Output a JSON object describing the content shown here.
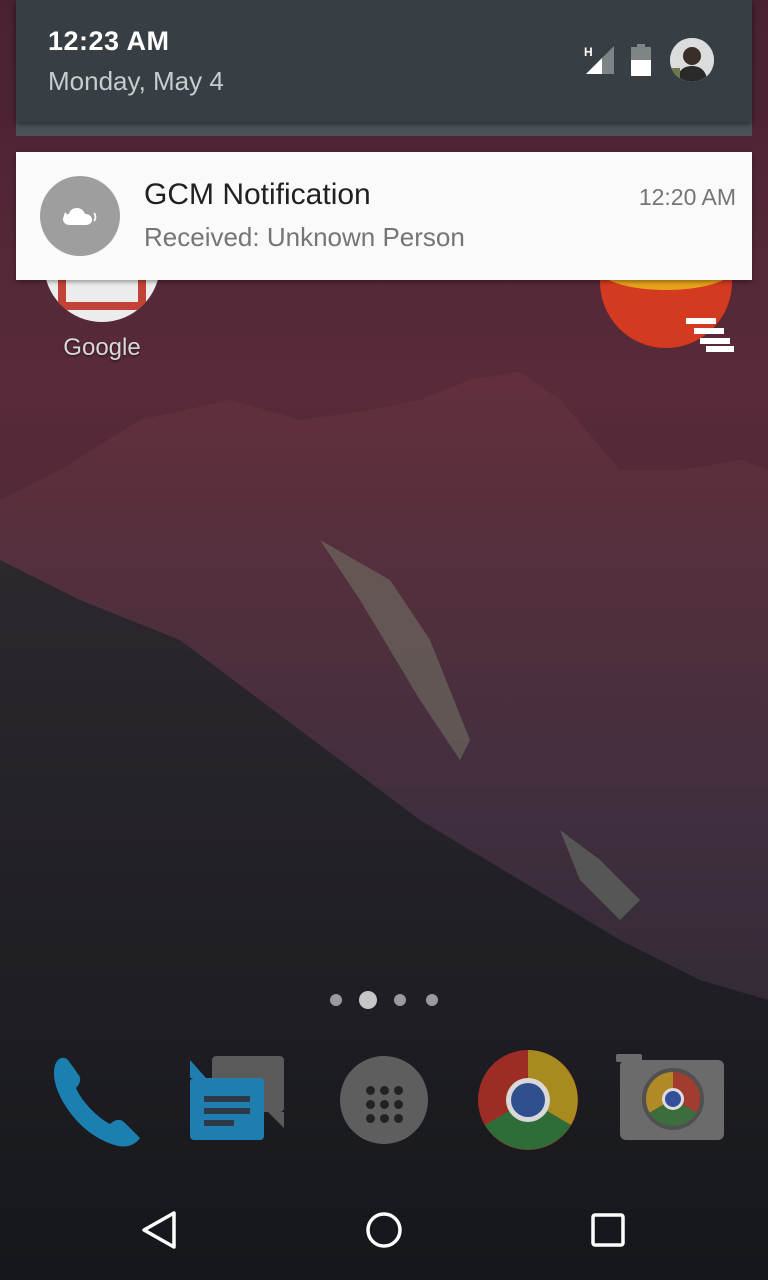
{
  "status_shade": {
    "time": "12:23 AM",
    "date": "Monday, May 4",
    "network_type": "H"
  },
  "notification": {
    "title": "GCM Notification",
    "text": "Received: Unknown Person",
    "time": "12:20 AM",
    "icon": "cloud-icon"
  },
  "home": {
    "google_folder_label": "Google",
    "page_count": 4,
    "active_page": 2
  },
  "dock": [
    "phone-icon",
    "messenger-icon",
    "apps-drawer-icon",
    "chrome-icon",
    "camera-icon"
  ],
  "navbar": [
    "back-button",
    "home-button",
    "recents-button"
  ],
  "colors": {
    "shade_header": "#373f44",
    "card": "#fafafa",
    "notif_icon_bg": "#9e9e9e"
  }
}
